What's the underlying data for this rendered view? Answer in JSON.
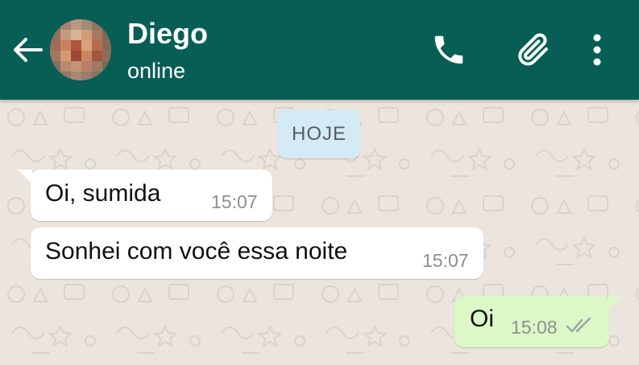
{
  "header": {
    "contact_name": "Diego",
    "status": "online",
    "icons": {
      "back": "arrow-left-icon",
      "call": "phone-icon",
      "attach": "paperclip-icon",
      "menu": "more-vertical-icon"
    }
  },
  "chat": {
    "date_divider": "HOJE",
    "messages": [
      {
        "direction": "incoming",
        "text": "Oi,  sumida",
        "time": "15:07"
      },
      {
        "direction": "incoming",
        "text": "Sonhei com você essa noite",
        "time": "15:07"
      },
      {
        "direction": "outgoing",
        "text": "Oi",
        "time": "15:08",
        "status_icon": "double-check-icon"
      }
    ]
  },
  "colors": {
    "header": "#075E54",
    "background": "#ECE5DD",
    "incoming_bubble": "#FFFFFF",
    "outgoing_bubble": "#DCF8C6",
    "date_chip": "#D4EAF4",
    "timestamp": "#8A8F91"
  }
}
